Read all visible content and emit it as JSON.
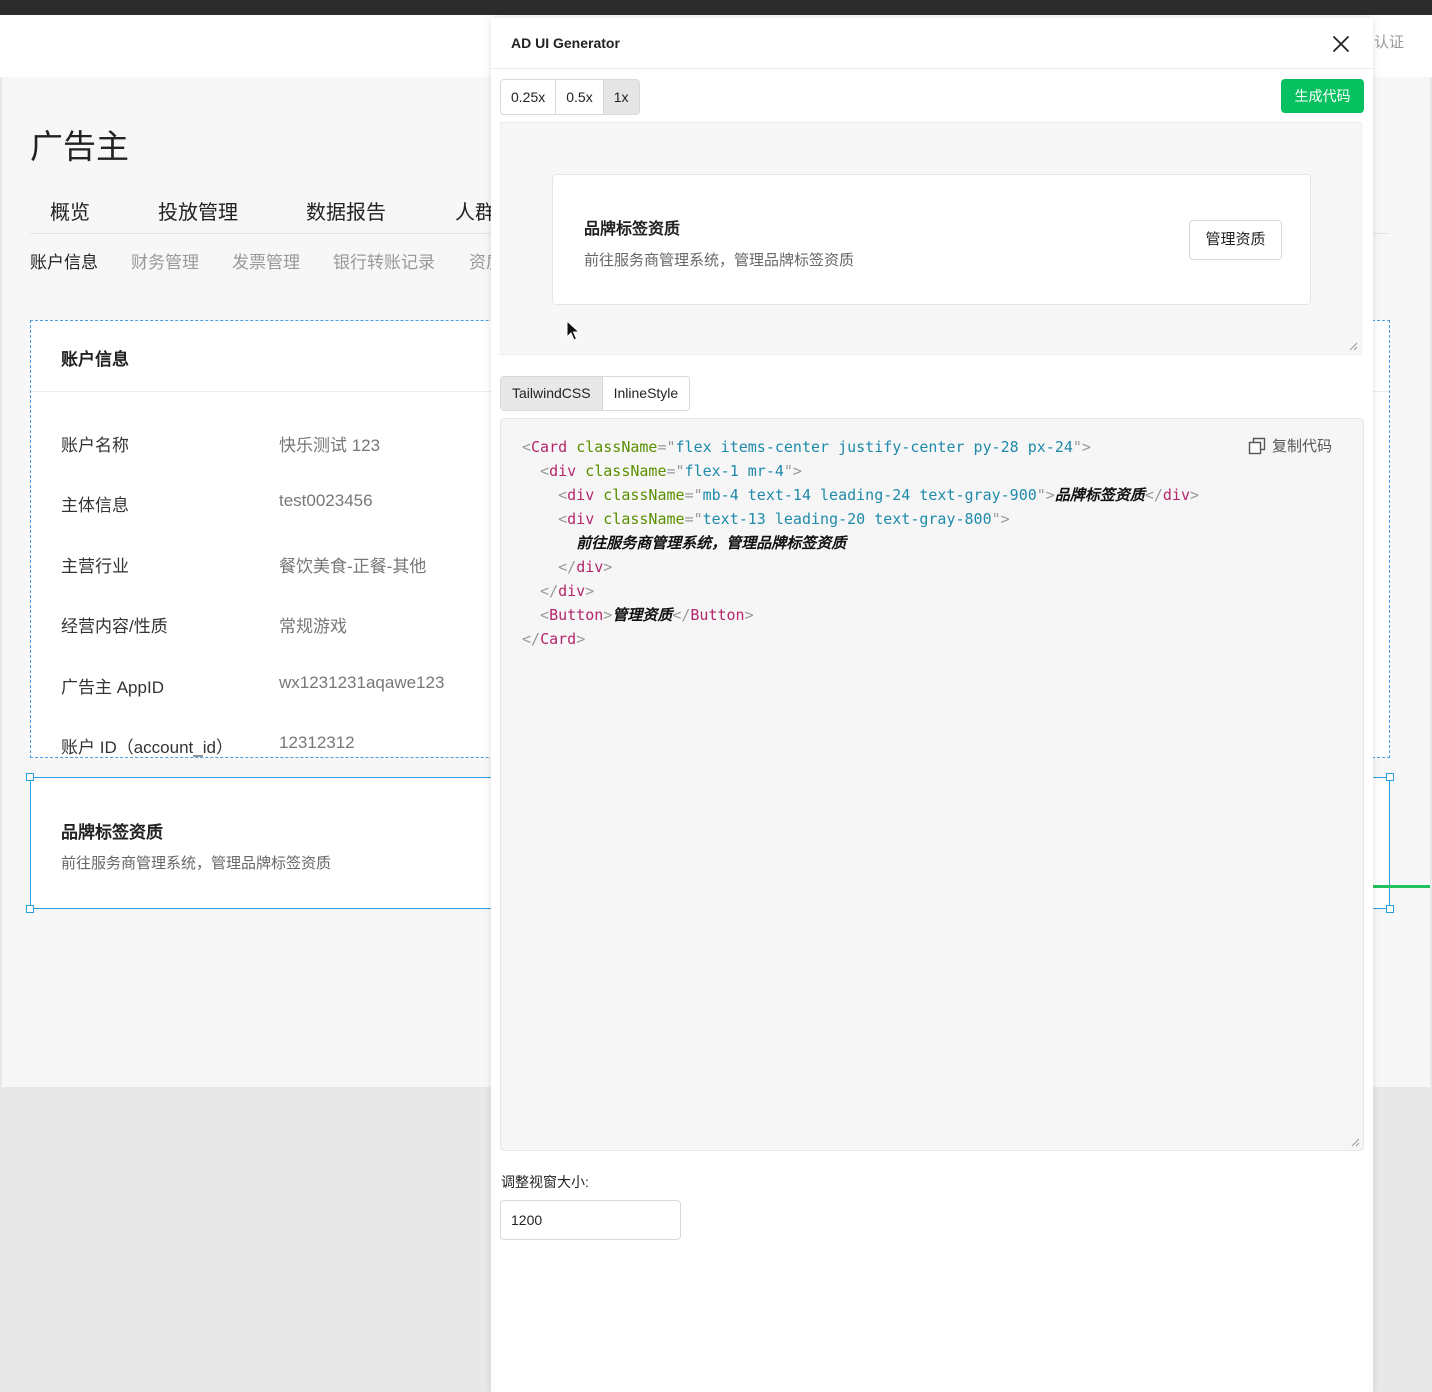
{
  "header": {
    "verify_text": "认证"
  },
  "page": {
    "title": "广告主",
    "nav_primary": [
      "概览",
      "投放管理",
      "数据报告",
      "人群"
    ],
    "nav_secondary": [
      "账户信息",
      "财务管理",
      "发票管理",
      "银行转账记录",
      "资质"
    ]
  },
  "account_card": {
    "title": "账户信息",
    "rows": [
      {
        "label": "账户名称",
        "value": "快乐测试 123"
      },
      {
        "label": "主体信息",
        "value": "test0023456"
      },
      {
        "label": "主营行业",
        "value": "餐饮美食-正餐-其他"
      },
      {
        "label": "经营内容/性质",
        "value": "常规游戏"
      },
      {
        "label": "广告主 AppID",
        "value": "wx1231231aqawe123"
      },
      {
        "label": "账户 ID（account_id）",
        "value": "12312312"
      }
    ]
  },
  "brand_card": {
    "title": "品牌标签资质",
    "desc": "前往服务商管理系统，管理品牌标签资质"
  },
  "modal": {
    "title": "AD UI Generator",
    "scales": [
      "0.25x",
      "0.5x",
      "1x"
    ],
    "active_scale": "1x",
    "generate_label": "生成代码",
    "preview": {
      "title": "品牌标签资质",
      "desc": "前往服务商管理系统，管理品牌标签资质",
      "button": "管理资质"
    },
    "tabs": [
      "TailwindCSS",
      "InlineStyle"
    ],
    "active_tab": "TailwindCSS",
    "copy_label": "复制代码",
    "code_lines": [
      [
        [
          "p",
          "<"
        ],
        [
          "tag",
          "Card"
        ],
        [
          "p",
          " "
        ],
        [
          "attr",
          "className"
        ],
        [
          "p",
          "=\""
        ],
        [
          "str",
          "flex items-center justify-center py-28 px-24"
        ],
        [
          "p",
          "\">"
        ]
      ],
      [
        [
          "p",
          "  <"
        ],
        [
          "tag",
          "div"
        ],
        [
          "p",
          " "
        ],
        [
          "attr",
          "className"
        ],
        [
          "p",
          "=\""
        ],
        [
          "str",
          "flex-1 mr-4"
        ],
        [
          "p",
          "\">"
        ]
      ],
      [
        [
          "p",
          "    <"
        ],
        [
          "tag",
          "div"
        ],
        [
          "p",
          " "
        ],
        [
          "attr",
          "className"
        ],
        [
          "p",
          "=\""
        ],
        [
          "str",
          "mb-4 text-14 leading-24 text-gray-900"
        ],
        [
          "p",
          "\">"
        ],
        [
          "txt",
          "品牌标签资质"
        ],
        [
          "p",
          "</"
        ],
        [
          "tag",
          "div"
        ],
        [
          "p",
          ">"
        ]
      ],
      [
        [
          "p",
          "    <"
        ],
        [
          "tag",
          "div"
        ],
        [
          "p",
          " "
        ],
        [
          "attr",
          "className"
        ],
        [
          "p",
          "=\""
        ],
        [
          "str",
          "text-13 leading-20 text-gray-800"
        ],
        [
          "p",
          "\">"
        ]
      ],
      [
        [
          "p",
          "      "
        ],
        [
          "txt",
          "前往服务商管理系统，管理品牌标签资质"
        ]
      ],
      [
        [
          "p",
          "    </"
        ],
        [
          "tag",
          "div"
        ],
        [
          "p",
          ">"
        ]
      ],
      [
        [
          "p",
          "  </"
        ],
        [
          "tag",
          "div"
        ],
        [
          "p",
          ">"
        ]
      ],
      [
        [
          "p",
          "  <"
        ],
        [
          "tag",
          "Button"
        ],
        [
          "p",
          ">"
        ],
        [
          "txt",
          "管理资质"
        ],
        [
          "p",
          "</"
        ],
        [
          "tag",
          "Button"
        ],
        [
          "p",
          ">"
        ]
      ],
      [
        [
          "p",
          "</"
        ],
        [
          "tag",
          "Card"
        ],
        [
          "p",
          ">"
        ]
      ]
    ],
    "viewport_label": "调整视窗大小:",
    "viewport_value": "1200"
  }
}
